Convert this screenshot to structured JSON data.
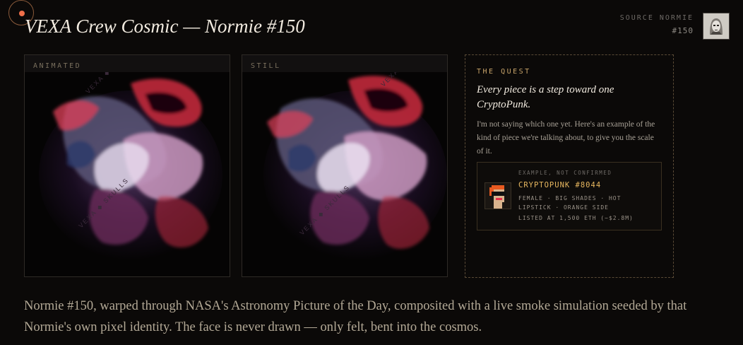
{
  "header": {
    "title": "VEXA Crew Cosmic — Normie #150",
    "source_label": "SOURCE NORMIE",
    "source_number": "#150",
    "source_thumb_icon": "normie-portrait-icon"
  },
  "panels": [
    {
      "label": "ANIMATED",
      "watermark": "VEXA ◆ SKULLS"
    },
    {
      "label": "STILL",
      "watermark": "VEXA ◆ SKULLS"
    }
  ],
  "quest": {
    "label": "THE QUEST",
    "headline": "Every piece is a step toward one CryptoPunk.",
    "body": "I'm not saying which one yet. Here's an example of the kind of piece we're talking about, to give you the scale of it.",
    "card": {
      "example_label": "EXAMPLE, NOT CONFIRMED",
      "punk_name": "CRYPTOPUNK #8044",
      "traits": "FEMALE · BIG SHADES · HOT LIPSTICK · ORANGE SIDE",
      "listing": "LISTED AT 1,500 ETH (~$2.8M)",
      "punk_icon": "cryptopunk-icon"
    }
  },
  "description": "Normie #150, warped through NASA's Astronomy Picture of the Day, composited with a live smoke simulation seeded by that Normie's own pixel identity. The face is never drawn — only felt, bent into the cosmos.",
  "colors": {
    "accent": "#f0704a",
    "gold": "#c8a46a",
    "punk_name": "#e8b860",
    "background": "#0b0908"
  }
}
